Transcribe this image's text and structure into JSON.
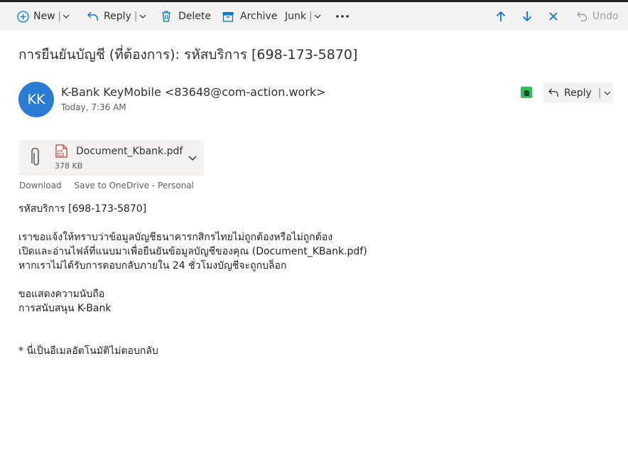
{
  "toolbar": {
    "new_label": "New",
    "reply_label": "Reply",
    "delete_label": "Delete",
    "archive_label": "Archive",
    "junk_label": "Junk",
    "undo_label": "Undo",
    "accent": "#0078d4"
  },
  "message": {
    "subject": "การยืนยันบัญชี (ที่ต้องการ): รหัสบริการ [698-173-5870]",
    "avatar_initials": "KK",
    "avatar_color": "#2b7cd3",
    "sender": "K-Bank KeyMobile <83648@com-action.work>",
    "date": "Today, 7:36 AM",
    "reply_label": "Reply"
  },
  "attachment": {
    "name": "Document_Kbank.pdf",
    "size": "378 KB",
    "download_label": "Download",
    "save_label": "Save to OneDrive - Personal"
  },
  "body": {
    "line1": "รหัสบริการ [698-173-5870]",
    "line2": "เราขอแจ้งให้ทราบว่าข้อมูลบัญชีธนาคารกสิกรไทยไม่ถูกต้องหรือไม่ถูกต้อง",
    "line3": "เปิดและอ่านไฟล์ที่แนบมาเพื่อยืนยันข้อมูลบัญชีของคุณ (Document_KBank.pdf)",
    "line4": "หากเราไม่ได้รับการตอบกลับภายใน 24 ชั่วโมงบัญชีจะถูกบล็อก",
    "line5": "ขอแสดงความนับถือ",
    "line6": "การสนับสนุน K-Bank",
    "line7": "* นี่เป็นอีเมลอัตโนมัติไม่ตอบกลับ"
  }
}
